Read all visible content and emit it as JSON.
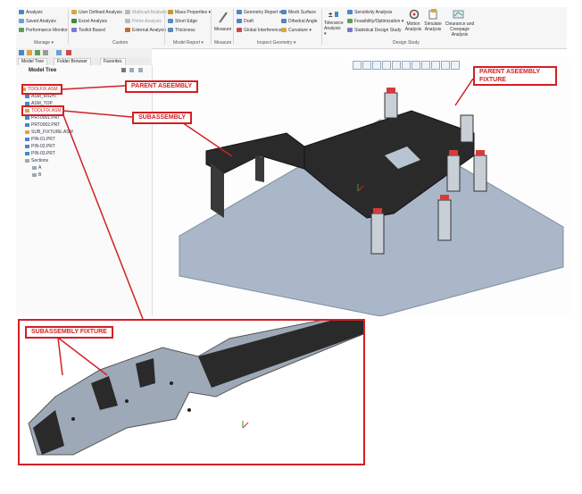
{
  "ribbon": {
    "manage": {
      "items": [
        "Analysis",
        "Saved Analysis",
        "Performance Monitor"
      ],
      "label": "Manage ▾"
    },
    "custom": {
      "items": [
        "User Defined Analysis",
        "Excel Analysis",
        "Toolkit Based",
        "Mathcad Analysis",
        "Prime Analysis",
        "External Analysis"
      ],
      "label": "Custom"
    },
    "model_report": {
      "items": [
        "Mass Properties ▾",
        "Short Edge",
        "Thickness"
      ],
      "label": "Model Report ▾"
    },
    "measure": {
      "button": "Measure",
      "label": "Measure"
    },
    "inspect_geometry": {
      "items": [
        "Geometry Report ▾",
        "Draft",
        "Global Interference ▾",
        "Mesh Surface",
        "Dihedral Angle",
        "Curvature ▾"
      ],
      "label": "Inspect Geometry ▾"
    },
    "design_study": {
      "items": [
        "Sensitivity Analysis",
        "Feasibility/Optimization ▾",
        "Statistical Design Study"
      ],
      "tolerance": "Tolerance Analysis ▾",
      "motion": "Motion Analysis",
      "simulate": "Simulate Analysis",
      "clearance": "Clearance and Creepage Analysis",
      "label": "Design Study"
    }
  },
  "panel": {
    "tabs": [
      "Model Tree",
      "Folder Browser",
      "Favorites"
    ],
    "tree_title": "Model Tree",
    "nodes": [
      "TOOLFIX.ASM",
      "ASM_RIGHT",
      "ASM_TOP",
      "TOOLFIX.ASM",
      "PRT0001.PRT",
      "PRT0002.PRT",
      "SUB_FIXTURE.ASM",
      "PIN-01.PRT",
      "PIN-02.PRT",
      "PIN-03.PRT",
      "Sections",
      "A",
      "B"
    ]
  },
  "annotations": {
    "parent_assembly": "PARENT ASEEMBLY",
    "subassembly": "SUBASSEMBLY",
    "parent_fixture_line1": "PARENT ASEEMBLY",
    "parent_fixture_line2": "FIXTURE",
    "subassembly_fixture": "SUBASSEMBLY FIXTURE"
  },
  "colors": {
    "callout": "#d21f25",
    "plate": "#a9b7c8",
    "part": "#2a2a2a",
    "clamp": "#d83a3a"
  }
}
